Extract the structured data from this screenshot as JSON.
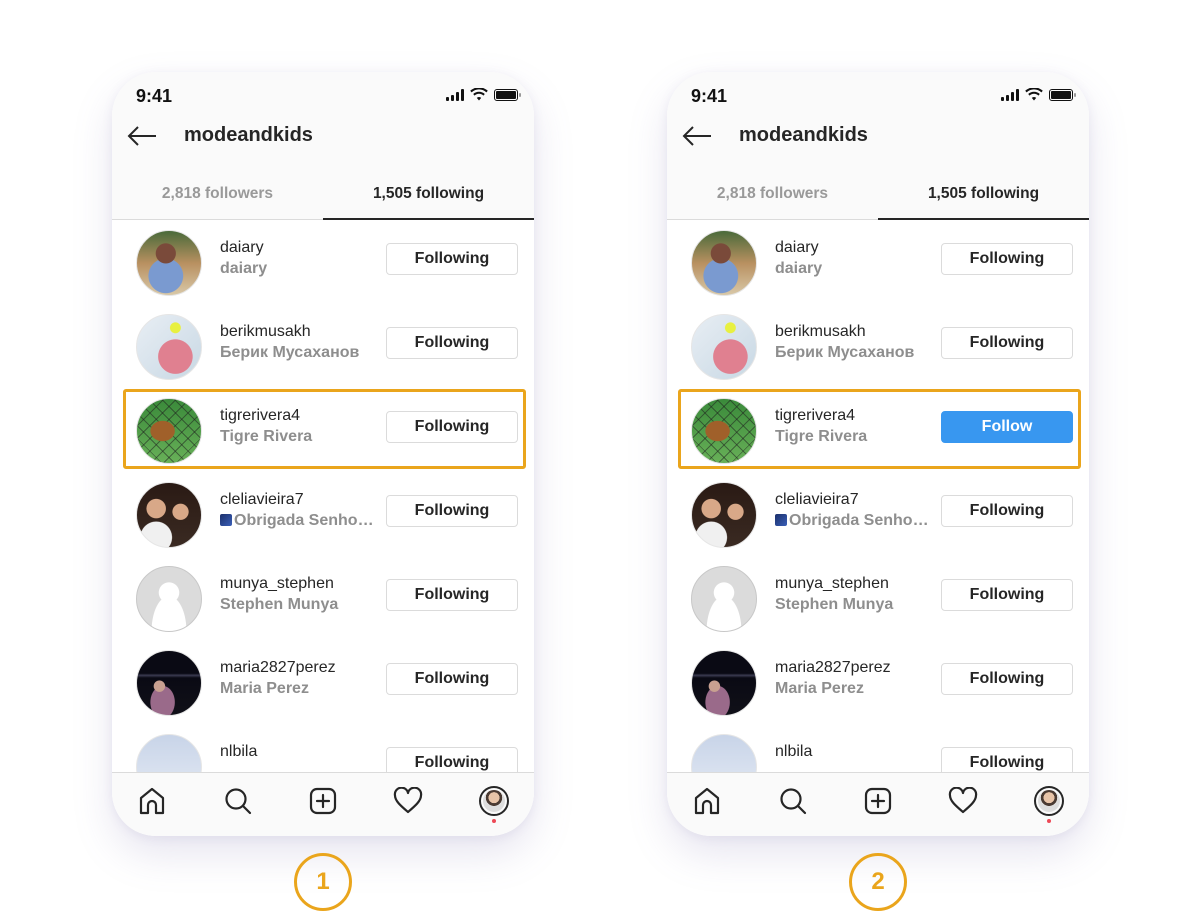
{
  "phones": [
    {
      "step": "1",
      "status_bar": {
        "time": "9:41"
      },
      "header": {
        "title": "modeandkids"
      },
      "tabs": [
        {
          "label": "2,818 followers",
          "active": false
        },
        {
          "label": "1,505 following",
          "active": true
        }
      ],
      "rows": [
        {
          "username": "daiary",
          "fullname": "daiary",
          "button": "Following",
          "avatar": "photo-woman-blue-jacket"
        },
        {
          "username": "berikmusakh",
          "fullname": "Берик Мусаханов",
          "button": "Following",
          "avatar": "photo-child-pink-jacket"
        },
        {
          "username": "tigrerivera4",
          "fullname": "Tigre Rivera",
          "button": "Following",
          "avatar": "photo-tiger",
          "highlighted": true
        },
        {
          "username": "cleliavieira7",
          "fullname": "Obrigada Senho…",
          "fullname_emoji": true,
          "button": "Following",
          "avatar": "photo-couple"
        },
        {
          "username": "munya_stephen",
          "fullname": "Stephen Munya",
          "button": "Following",
          "avatar": "default-avatar"
        },
        {
          "username": "maria2827perez",
          "fullname": "Maria Perez",
          "button": "Following",
          "avatar": "photo-night-city"
        },
        {
          "username": "nlbila",
          "fullname": "",
          "button": "Following",
          "avatar": "photo-sky"
        }
      ]
    },
    {
      "step": "2",
      "status_bar": {
        "time": "9:41"
      },
      "header": {
        "title": "modeandkids"
      },
      "tabs": [
        {
          "label": "2,818 followers",
          "active": false
        },
        {
          "label": "1,505 following",
          "active": true
        }
      ],
      "rows": [
        {
          "username": "daiary",
          "fullname": "daiary",
          "button": "Following",
          "avatar": "photo-woman-blue-jacket"
        },
        {
          "username": "berikmusakh",
          "fullname": "Берик Мусаханов",
          "button": "Following",
          "avatar": "photo-child-pink-jacket"
        },
        {
          "username": "tigrerivera4",
          "fullname": "Tigre Rivera",
          "button": "Follow",
          "avatar": "photo-tiger",
          "highlighted": true
        },
        {
          "username": "cleliavieira7",
          "fullname": "Obrigada Senho…",
          "fullname_emoji": true,
          "button": "Following",
          "avatar": "photo-couple"
        },
        {
          "username": "munya_stephen",
          "fullname": "Stephen Munya",
          "button": "Following",
          "avatar": "default-avatar"
        },
        {
          "username": "maria2827perez",
          "fullname": "Maria Perez",
          "button": "Following",
          "avatar": "photo-night-city"
        },
        {
          "username": "nlbila",
          "fullname": "",
          "button": "Following",
          "avatar": "photo-sky"
        }
      ]
    }
  ],
  "tab_bar": [
    "home-icon",
    "search-icon",
    "new-post-icon",
    "activity-heart-icon",
    "profile-avatar"
  ],
  "colors": {
    "highlight": "#eaa51c",
    "follow_button": "#3897f0",
    "notification_dot": "#ed4956",
    "secondary_text": "#8e8e8e"
  }
}
